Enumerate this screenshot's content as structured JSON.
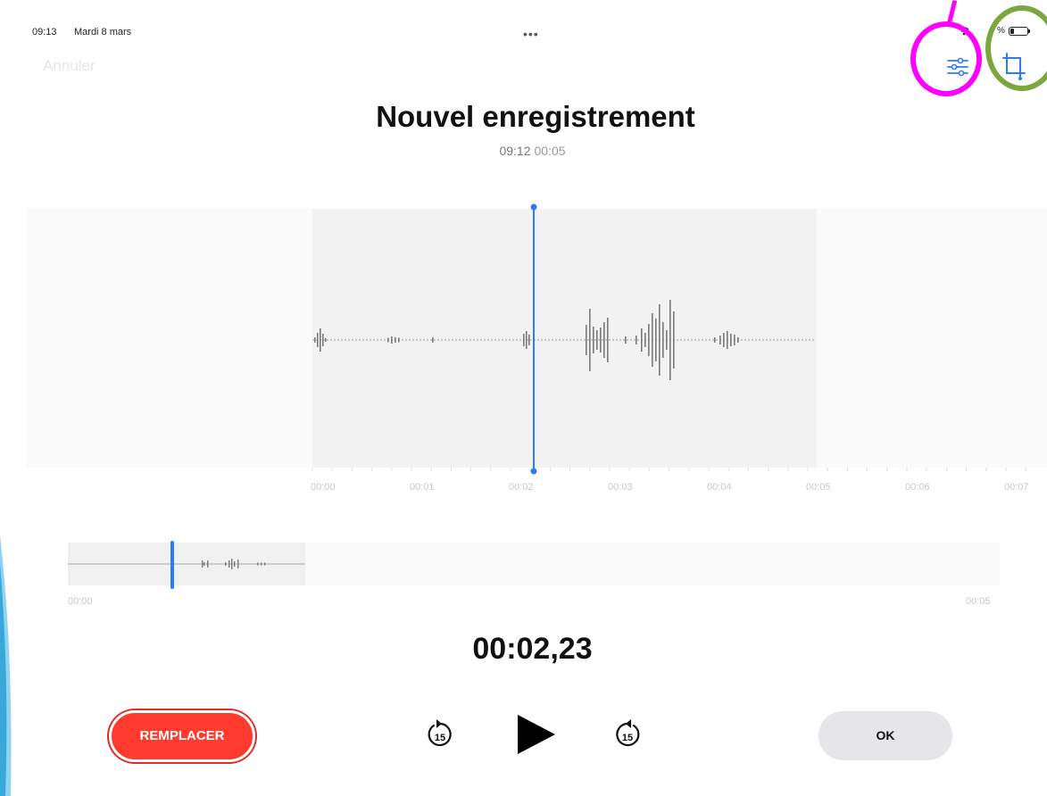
{
  "status_bar": {
    "time": "09:13",
    "date": "Mardi 8 mars",
    "dots": "•••",
    "battery_label": "%"
  },
  "toolbar": {
    "cancel_label": "Annuler",
    "adjust_icon": "sliders-icon",
    "crop_icon": "trim-crop-icon"
  },
  "recording": {
    "title": "Nouvel enregistrement",
    "time": "09:12",
    "duration": "00:05"
  },
  "waveform": {
    "time_labels": [
      "00:00",
      "00:01",
      "00:02",
      "00:03",
      "00:04",
      "00:05",
      "00:06",
      "00:07"
    ],
    "playhead_seconds": 2.23
  },
  "overview": {
    "start_label": "00:00",
    "end_label": "00:05"
  },
  "playback": {
    "current_time": "00:02,23",
    "skip_back_label": "15",
    "skip_forward_label": "15"
  },
  "actions": {
    "replace_label": "REMPLACER",
    "ok_label": "OK"
  },
  "colors": {
    "accent": "#2f7bf5",
    "replace": "#ff3b30",
    "annotation_pink": "#ff00ff",
    "annotation_green": "#7aa83f"
  }
}
